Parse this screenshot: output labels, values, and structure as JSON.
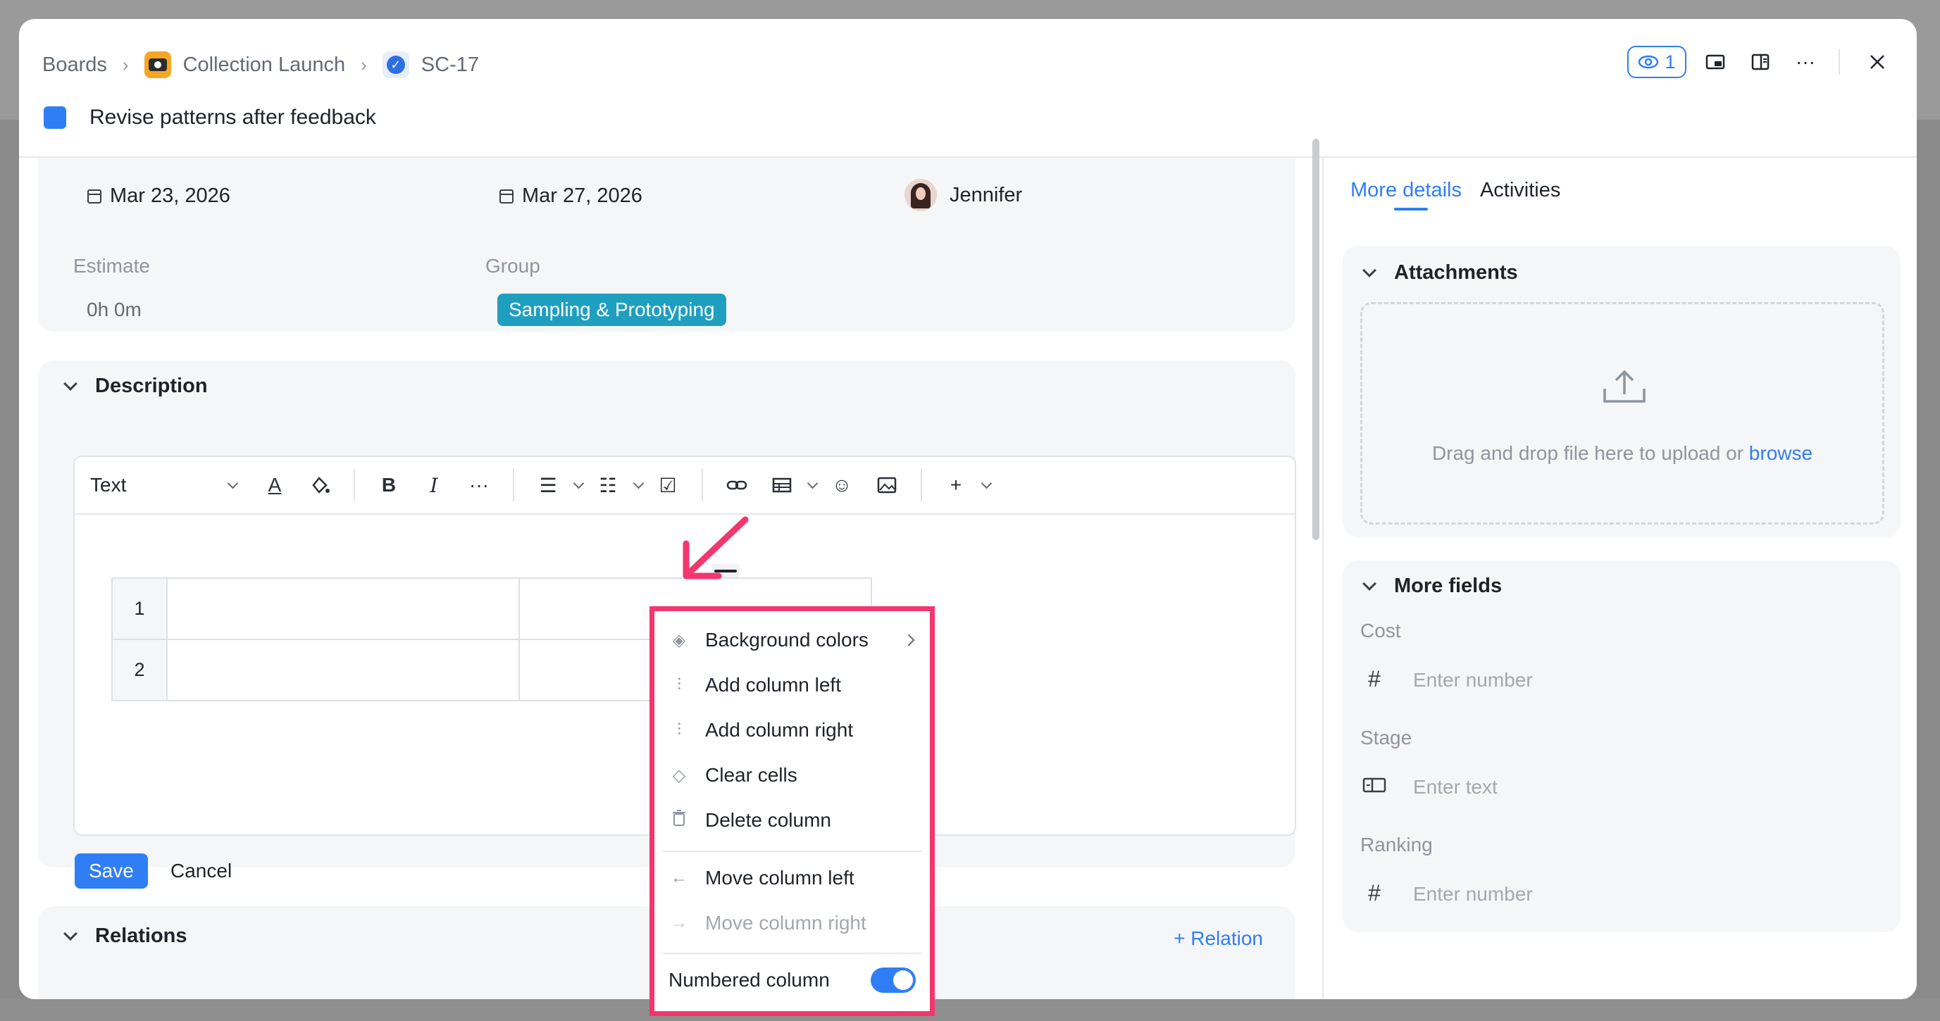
{
  "header": {
    "breadcrumbs": [
      "Boards",
      "Collection Launch",
      "SC-17"
    ],
    "title": "Revise patterns after feedback",
    "watchers_count": "1"
  },
  "details": {
    "start_date": "Mar 23, 2026",
    "due_date": "Mar 27, 2026",
    "assignee": "Jennifer",
    "estimate_label": "Estimate",
    "estimate_value": "0h 0m",
    "group_label": "Group",
    "group_value": "Sampling & Prototyping",
    "group_color": "#1f9fbf"
  },
  "description": {
    "heading": "Description",
    "toolbar": {
      "text_style": "Text",
      "icons": [
        "text-color-icon",
        "highlight-icon",
        "bold-icon",
        "italic-icon",
        "more-icon",
        "bullet-list-icon",
        "numbered-list-icon",
        "checklist-icon",
        "link-icon",
        "table-icon",
        "emoji-icon",
        "image-icon",
        "plus-icon"
      ]
    },
    "table_rows": [
      "1",
      "2"
    ],
    "save_label": "Save",
    "cancel_label": "Cancel"
  },
  "relations": {
    "heading": "Relations",
    "add_label": "+ Relation"
  },
  "sidebar": {
    "tabs": [
      "More details",
      "Activities"
    ],
    "active_tab": "More details",
    "attachments": {
      "heading": "Attachments",
      "drop_text": "Drag and drop file here to upload or",
      "browse_label": "browse"
    },
    "more_fields": {
      "heading": "More fields",
      "fields": [
        {
          "label": "Cost",
          "placeholder": "Enter number",
          "icon": "hash-icon"
        },
        {
          "label": "Stage",
          "placeholder": "Enter text",
          "icon": "text-field-icon"
        },
        {
          "label": "Ranking",
          "placeholder": "Enter number",
          "icon": "hash-icon"
        }
      ]
    }
  },
  "column_menu": {
    "items": [
      {
        "label": "Background colors",
        "icon": "paint-bucket-icon",
        "submenu": true
      },
      {
        "label": "Add column left",
        "icon": "add-column-left-icon"
      },
      {
        "label": "Add column right",
        "icon": "add-column-right-icon"
      },
      {
        "label": "Clear cells",
        "icon": "eraser-icon"
      },
      {
        "label": "Delete column",
        "icon": "trash-icon"
      },
      {
        "label": "Move column left",
        "icon": "arrow-left-icon"
      },
      {
        "label": "Move column right",
        "icon": "arrow-right-icon",
        "disabled": true
      }
    ],
    "toggle_label": "Numbered column",
    "toggle_on": true,
    "highlight_color": "#f2366e"
  },
  "colors": {
    "accent": "#2f7ef5",
    "annotation": "#f2366e"
  }
}
